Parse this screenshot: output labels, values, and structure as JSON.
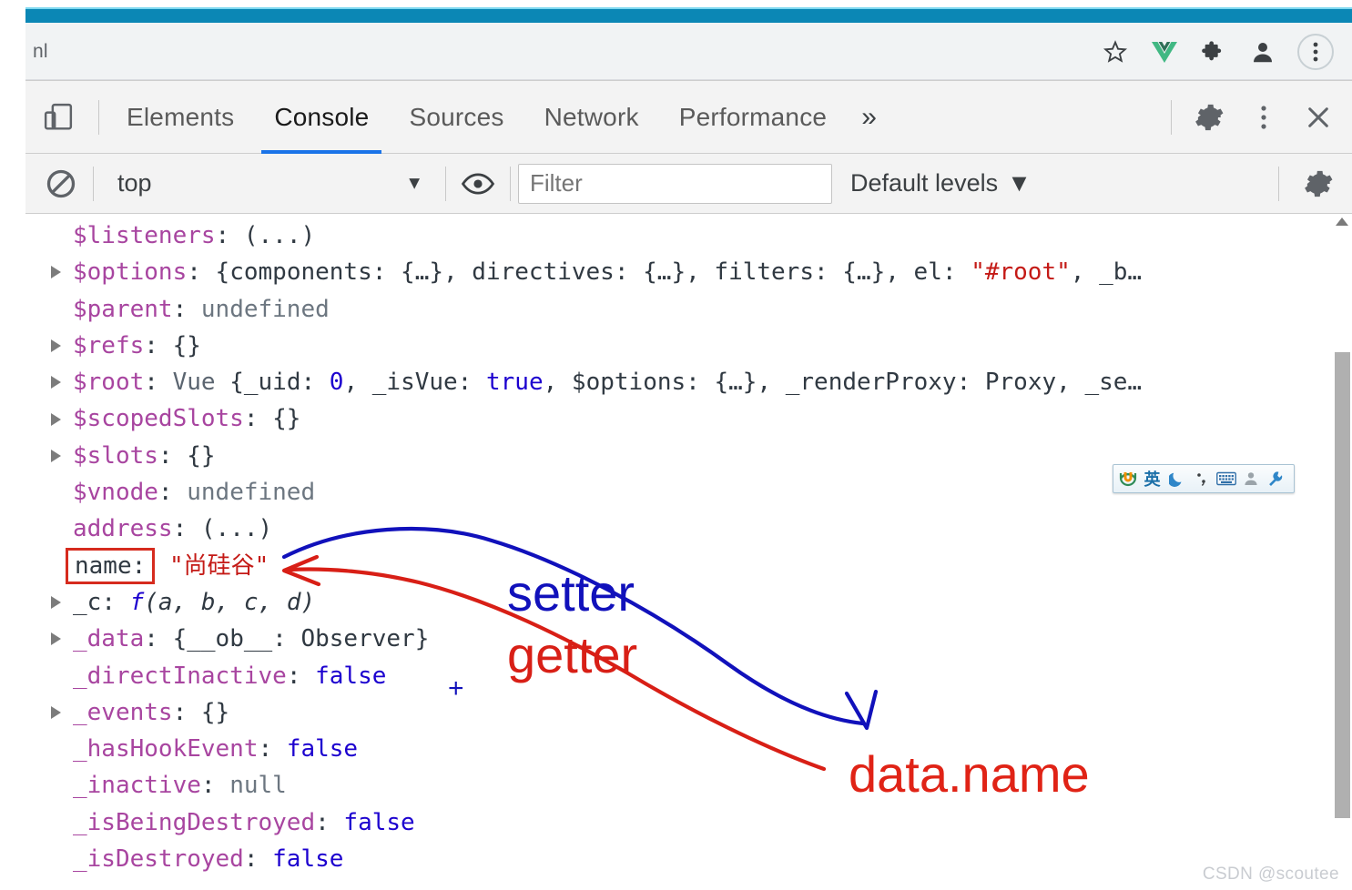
{
  "browser": {
    "url_fragment": "nl",
    "actions": [
      {
        "name": "bookmark-star-icon",
        "label": "Bookmark"
      },
      {
        "name": "vue-devtools-icon",
        "label": "Vue"
      },
      {
        "name": "extensions-puzzle-icon",
        "label": "Extensions"
      },
      {
        "name": "profile-avatar-icon",
        "label": "Profile"
      },
      {
        "name": "chrome-menu-icon",
        "label": "Customize and control"
      }
    ],
    "progress_bar_color": "#0b87b5"
  },
  "devtools": {
    "inspect_button": "inspect-element-icon",
    "tabs": [
      {
        "label": "Elements",
        "active": false
      },
      {
        "label": "Console",
        "active": true
      },
      {
        "label": "Sources",
        "active": false
      },
      {
        "label": "Network",
        "active": false
      },
      {
        "label": "Performance",
        "active": false
      }
    ],
    "more_tabs": "»",
    "active_tab_underline_color": "#1a73e8",
    "right_icons": [
      {
        "name": "settings-gear-icon"
      },
      {
        "name": "devtools-more-options-icon"
      },
      {
        "name": "close-devtools-icon"
      }
    ],
    "filterbar": {
      "clear_console": "clear-console-icon",
      "context": "top",
      "context_caret": "▼",
      "eye_icon": "live-expression-eye-icon",
      "filter_placeholder": "Filter",
      "filter_value": "",
      "levels": "Default levels",
      "levels_caret": "▼",
      "settings_icon": "console-settings-gear-icon"
    }
  },
  "console": {
    "rows": [
      {
        "disclosure": false,
        "key": "$listeners",
        "key_kind": "proto",
        "sep": ": ",
        "value": "(...)",
        "value_kind": "plain"
      },
      {
        "disclosure": true,
        "key": "$options",
        "key_kind": "proto",
        "sep": ": ",
        "value": "{components: {…}, directives: {…}, filters: {…}, el: \"#root\", _b…",
        "value_kind": "object-preview",
        "string_token": "\"#root\""
      },
      {
        "disclosure": false,
        "key": "$parent",
        "key_kind": "proto",
        "sep": ": ",
        "value": "undefined",
        "value_kind": "undef"
      },
      {
        "disclosure": true,
        "key": "$refs",
        "key_kind": "proto",
        "sep": ": ",
        "value": "{}",
        "value_kind": "plain"
      },
      {
        "disclosure": true,
        "key": "$root",
        "key_kind": "proto",
        "sep": ": ",
        "value": "Vue {_uid: 0, _isVue: true, $options: {…}, _renderProxy: Proxy, _se…",
        "value_kind": "object-preview",
        "class_token": "Vue",
        "num_token": "0",
        "bool_token": "true"
      },
      {
        "disclosure": true,
        "key": "$scopedSlots",
        "key_kind": "proto",
        "sep": ": ",
        "value": "{}",
        "value_kind": "plain"
      },
      {
        "disclosure": true,
        "key": "$slots",
        "key_kind": "proto",
        "sep": ": ",
        "value": "{}",
        "value_kind": "plain"
      },
      {
        "disclosure": false,
        "key": "$vnode",
        "key_kind": "proto",
        "sep": ": ",
        "value": "undefined",
        "value_kind": "undef"
      },
      {
        "disclosure": false,
        "key": "address",
        "key_kind": "proto",
        "sep": ": ",
        "value": "(...)",
        "value_kind": "plain"
      },
      {
        "disclosure": false,
        "key": "name",
        "key_kind": "boxed",
        "sep": ": ",
        "value": "\"尚硅谷\"",
        "value_kind": "str",
        "highlight_color": "#d62b1e"
      },
      {
        "disclosure": true,
        "key": "_c",
        "key_kind": "proto",
        "sep": ": ",
        "value": "f (a, b, c, d)",
        "value_kind": "function",
        "fn_token": "f",
        "params_token": "(a, b, c, d)"
      },
      {
        "disclosure": true,
        "key": "_data",
        "key_kind": "proto",
        "sep": ": ",
        "value": "{__ob__: Observer}",
        "value_kind": "object-preview"
      },
      {
        "disclosure": false,
        "key": "_directInactive",
        "key_kind": "proto",
        "sep": ": ",
        "value": "false",
        "value_kind": "bool"
      },
      {
        "disclosure": true,
        "key": "_events",
        "key_kind": "proto",
        "sep": ": ",
        "value": "{}",
        "value_kind": "plain"
      },
      {
        "disclosure": false,
        "key": "_hasHookEvent",
        "key_kind": "proto",
        "sep": ": ",
        "value": "false",
        "value_kind": "bool"
      },
      {
        "disclosure": false,
        "key": "_inactive",
        "key_kind": "proto",
        "sep": ": ",
        "value": "null",
        "value_kind": "nul"
      },
      {
        "disclosure": false,
        "key": "_isBeingDestroyed",
        "key_kind": "proto",
        "sep": ": ",
        "value": "false",
        "value_kind": "bool"
      },
      {
        "disclosure": false,
        "key": "_isDestroyed",
        "key_kind": "proto",
        "sep": ": ",
        "value": "false",
        "value_kind": "bool"
      }
    ],
    "scrollbar": {
      "up_arrow": "scroll-up-arrow-icon",
      "thumb_color": "#b0b0b0"
    }
  },
  "annotations": {
    "setter": {
      "text": "setter",
      "color": "#1111bb"
    },
    "getter": {
      "text": "getter",
      "color": "#d81f16"
    },
    "data_name": {
      "text": "data.name",
      "color": "#e02316"
    },
    "plus": {
      "text": "+",
      "color": "#1111bb"
    }
  },
  "ime_bar": {
    "items": [
      {
        "name": "sogou-logo-icon",
        "glyph": ""
      },
      {
        "name": "input-mode-chinese-english-icon",
        "glyph": "英"
      },
      {
        "name": "moon-mode-icon",
        "glyph": ""
      },
      {
        "name": "punctuation-mode-icon",
        "glyph": ""
      },
      {
        "name": "soft-keyboard-icon",
        "glyph": ""
      },
      {
        "name": "user-account-icon",
        "glyph": ""
      },
      {
        "name": "ime-toolbox-wrench-icon",
        "glyph": ""
      }
    ]
  },
  "watermark": {
    "text": "CSDN @scoutee"
  }
}
